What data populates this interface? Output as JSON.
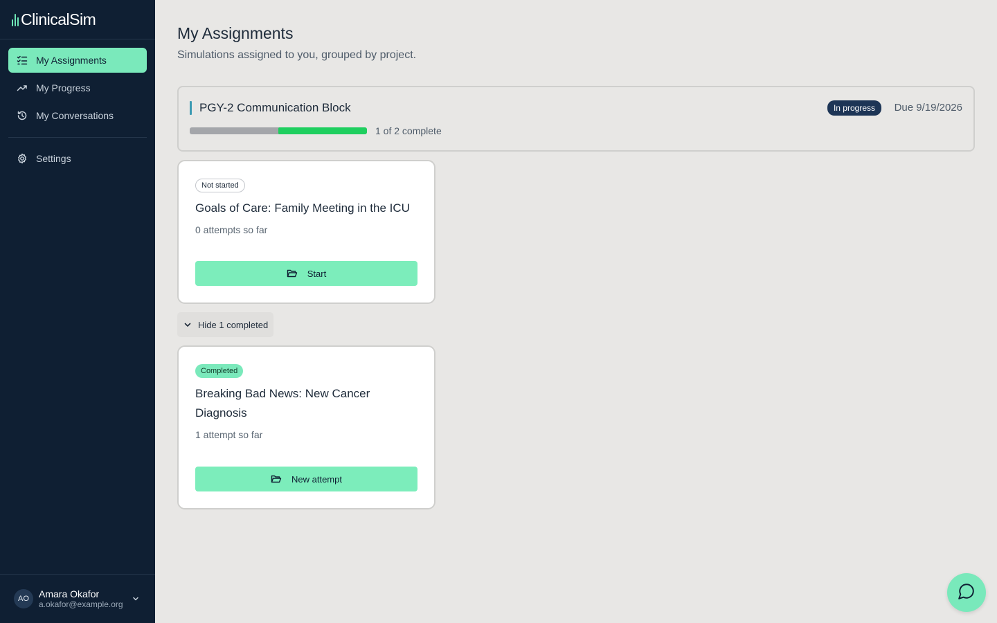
{
  "app": {
    "name": "ClinicalSim"
  },
  "sidebar": {
    "nav": [
      {
        "label": "My Assignments",
        "icon": "list-check-icon",
        "active": true
      },
      {
        "label": "My Progress",
        "icon": "trending-up-icon",
        "active": false
      },
      {
        "label": "My Conversations",
        "icon": "history-icon",
        "active": false
      }
    ],
    "settings": {
      "label": "Settings",
      "icon": "gear-icon"
    },
    "user": {
      "initials": "AO",
      "name": "Amara Okafor",
      "email": "a.okafor@example.org"
    }
  },
  "page": {
    "title": "My Assignments",
    "subtitle": "Simulations assigned to you, grouped by project."
  },
  "project": {
    "title": "PGY-2 Communication Block",
    "status": "In progress",
    "due": "Due 9/19/2026",
    "progress_text": "1 of 2 complete",
    "progress_completed": 1,
    "progress_total": 2
  },
  "assignments": [
    {
      "status": "Not started",
      "title": "Goals of Care: Family Meeting in the ICU",
      "attempts": "0 attempts so far",
      "button": "Start"
    }
  ],
  "completed_toggle": {
    "label": "Hide 1 completed"
  },
  "completed": [
    {
      "status": "Completed",
      "title": "Breaking Bad News: New Cancer Diagnosis",
      "attempts": "1 attempt so far",
      "button": "New attempt"
    }
  ],
  "colors": {
    "sidebar_bg": "#0f1f33",
    "accent": "#7ae9bb",
    "progress_fill": "#1fcf5f",
    "status_badge": "#1d3556"
  },
  "fab": {
    "icon": "chat-bubble-icon"
  }
}
